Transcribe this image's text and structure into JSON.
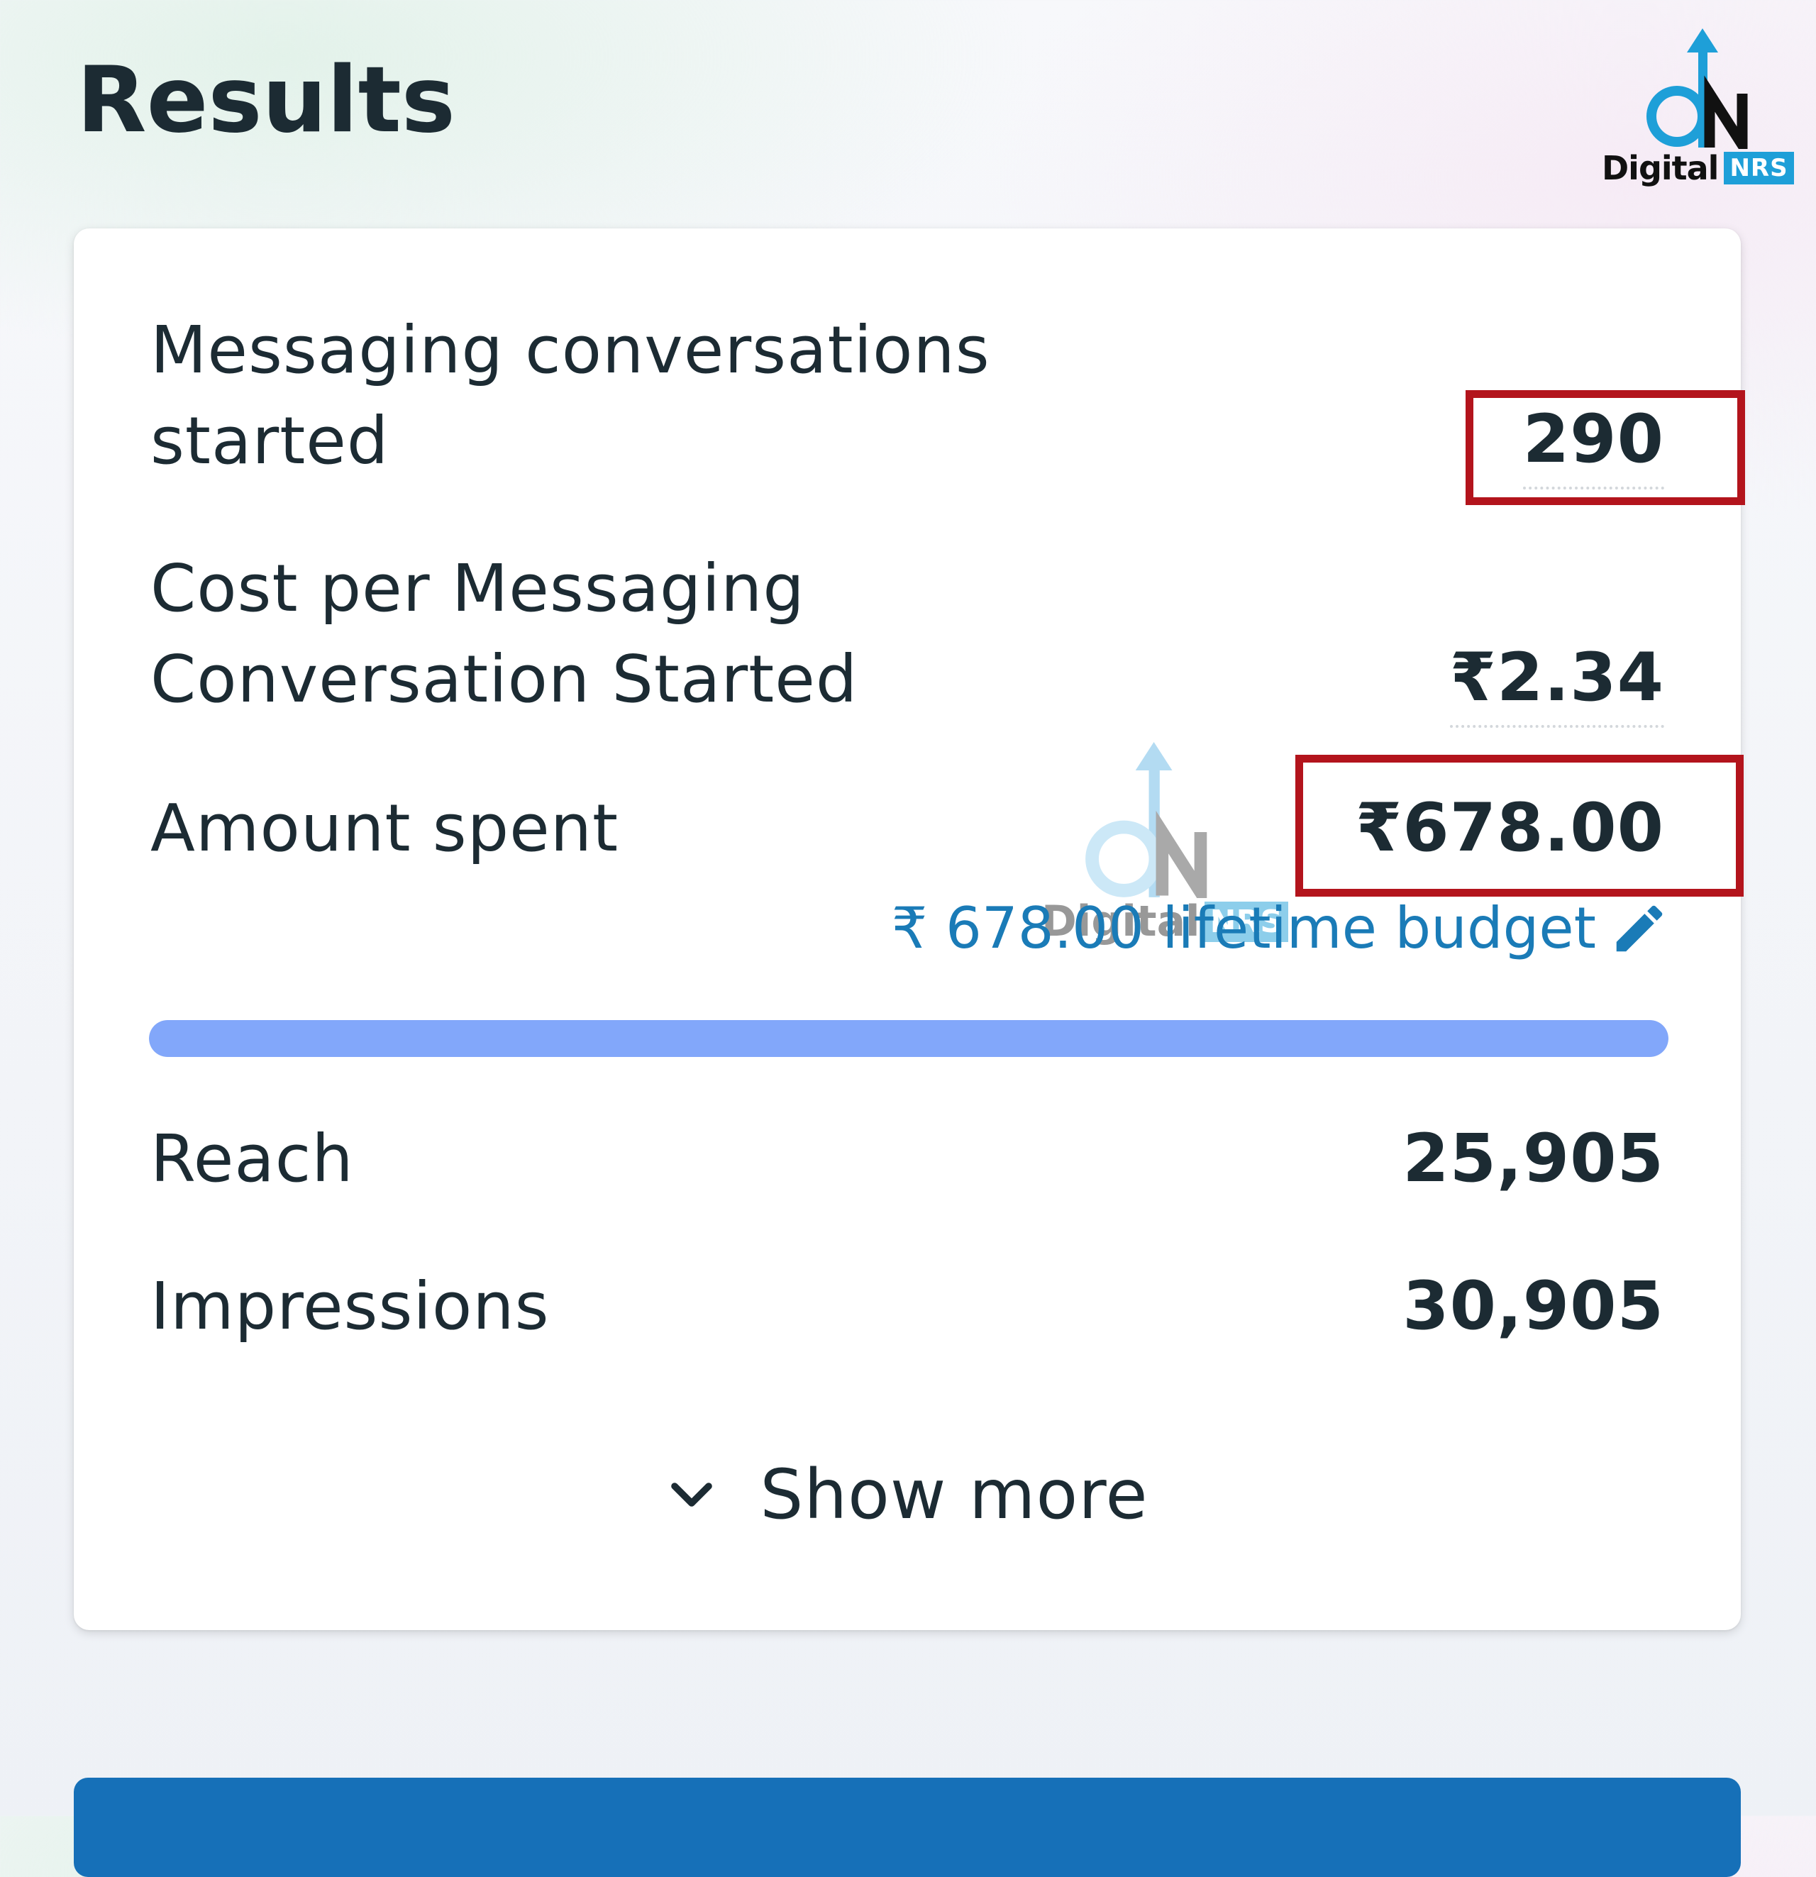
{
  "page": {
    "title": "Results"
  },
  "logo": {
    "word": "Digital",
    "tag": "NRS"
  },
  "watermark": {
    "word": "Digital",
    "tag": "NRS"
  },
  "results": {
    "messaging": {
      "label_line1": "Messaging conversations",
      "label_line2": "started",
      "value": "290",
      "highlighted": true
    },
    "cost_per": {
      "label_line1": "Cost per Messaging",
      "label_line2": "Conversation Started",
      "value": "₹2.34"
    },
    "amount_spent": {
      "label": "Amount spent",
      "value": "₹678.00",
      "highlighted": true
    },
    "budget": {
      "text": "₹ 678.00 lifetime budget",
      "icon": "pencil-icon"
    },
    "progress": {
      "fraction": 1.0
    },
    "reach": {
      "label": "Reach",
      "value": "25,905"
    },
    "impressions": {
      "label": "Impressions",
      "value": "30,905"
    },
    "show_more": {
      "label": "Show more",
      "icon": "chevron-down-icon"
    }
  },
  "colors": {
    "text": "#1c2b33",
    "link": "#1a7bb7",
    "progress": "#82a7fa",
    "highlight": "#b3141c",
    "primary_button": "#1670b8",
    "brand_blue": "#1e9fd8"
  }
}
